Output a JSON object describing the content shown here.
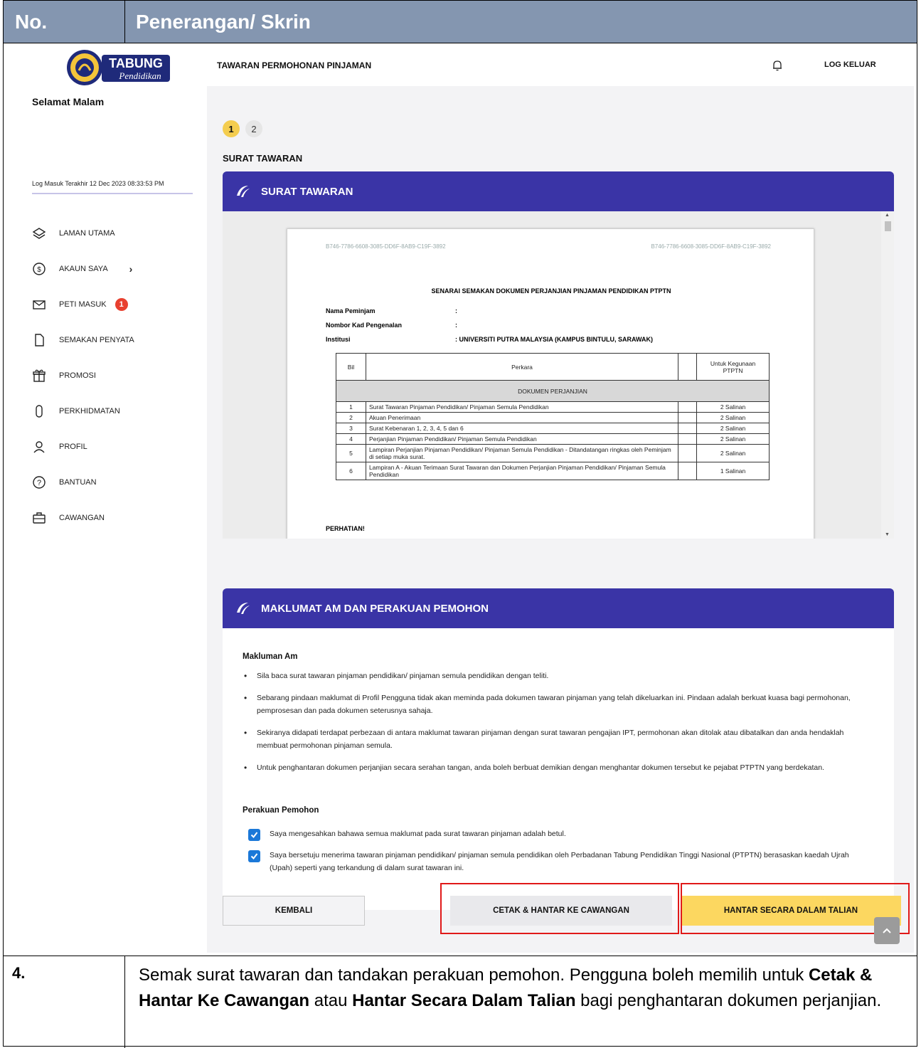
{
  "doc": {
    "header_no": "No.",
    "header_desc": "Penerangan/ Skrin",
    "step_no": "4.",
    "step_desc_1": "Semak surat tawaran dan tandakan perakuan pemohon. Pengguna boleh memilih untuk ",
    "step_desc_b1": "Cetak & Hantar Ke Cawangan",
    "step_desc_2": " atau ",
    "step_desc_b2": "Hantar Secara Dalam Talian",
    "step_desc_3": " bagi penghantaran dokumen perjanjian."
  },
  "logo": {
    "line1": "TABUNG",
    "line2": "Pendidikan"
  },
  "sidebar": {
    "greeting": "Selamat Malam",
    "last_login": "Log Masuk Terakhir 12 Dec 2023 08:33:53 PM",
    "items": [
      {
        "label": "LAMAN UTAMA",
        "icon": "layers-icon"
      },
      {
        "label": "AKAUN SAYA",
        "icon": "dollar-circle-icon"
      },
      {
        "label": "PETI MASUK",
        "icon": "mail-icon",
        "badge": "1"
      },
      {
        "label": "SEMAKAN PENYATA",
        "icon": "document-icon"
      },
      {
        "label": "PROMOSI",
        "icon": "gift-icon"
      },
      {
        "label": "PERKHIDMATAN",
        "icon": "mouse-icon"
      },
      {
        "label": "PROFIL",
        "icon": "user-icon"
      },
      {
        "label": "BANTUAN",
        "icon": "help-icon"
      },
      {
        "label": "CAWANGAN",
        "icon": "briefcase-icon"
      }
    ]
  },
  "header": {
    "title": "TAWARAN PERMOHONAN PINJAMAN",
    "logout": "LOG KELUAR"
  },
  "stepper": [
    "1",
    "2"
  ],
  "section_label": "SURAT TAWARAN",
  "card1": {
    "title": "SURAT TAWARAN"
  },
  "letter": {
    "code_left": "B746-7786-6608-3085-DD6F-8AB9-C19F-3892",
    "code_right": "B746-7786-6608-3085-DD6F-8AB9-C19F-3892",
    "title": "SENARAI SEMAKAN DOKUMEN PERJANJIAN PINJAMAN PENDIDIKAN PTPTN",
    "fields": [
      {
        "k": "Nama Peminjam",
        "v": ":"
      },
      {
        "k": "Nombor Kad Pengenalan",
        "v": ":"
      },
      {
        "k": "Institusi",
        "v": ": UNIVERSITI PUTRA MALAYSIA (KAMPUS BINTULU, SARAWAK)"
      }
    ],
    "table_headers": [
      "Bil",
      "Perkara",
      "",
      "Untuk Kegunaan PTPTN"
    ],
    "group": "DOKUMEN PERJANJIAN",
    "rows": [
      {
        "bil": "1",
        "perkara": "Surat Tawaran Pinjaman Pendidikan/ Pinjaman Semula Pendidikan",
        "guna": "2 Salinan"
      },
      {
        "bil": "2",
        "perkara": "Akuan Penerimaan",
        "guna": "2 Salinan"
      },
      {
        "bil": "3",
        "perkara": "Surat Kebenaran 1, 2, 3, 4, 5 dan 6",
        "guna": "2 Salinan"
      },
      {
        "bil": "4",
        "perkara": "Perjanjian Pinjaman Pendidikan/ Pinjaman Semula Pendidikan",
        "guna": "2 Salinan"
      },
      {
        "bil": "5",
        "perkara": "Lampiran Perjanjian Pinjaman Pendidikan/ Pinjaman Semula Pendidikan - Ditandatangan ringkas oleh Peminjam di setiap muka surat.",
        "guna": "2 Salinan"
      },
      {
        "bil": "6",
        "perkara": "Lampiran A - Akuan Terimaan Surat Tawaran dan Dokumen Perjanjian Pinjaman Pendidikan/ Pinjaman Semula Pendidikan",
        "guna": "1 Salinan"
      }
    ],
    "perhatian": "PERHATIAN!"
  },
  "card2": {
    "title": "MAKLUMAT AM DAN PERAKUAN PEMOHON",
    "makluman_heading": "Makluman Am",
    "bullets": [
      "Sila baca surat tawaran pinjaman pendidikan/ pinjaman semula pendidikan dengan teliti.",
      "Sebarang pindaan maklumat di Profil Pengguna tidak akan meminda pada dokumen tawaran pinjaman yang telah dikeluarkan ini. Pindaan adalah berkuat kuasa bagi permohonan, pemprosesan dan pada dokumen seterusnya sahaja.",
      "Sekiranya didapati terdapat perbezaan di antara maklumat tawaran pinjaman dengan surat tawaran pengajian IPT, permohonan akan ditolak atau dibatalkan dan anda hendaklah membuat permohonan pinjaman semula.",
      "Untuk penghantaran dokumen perjanjian secara serahan tangan, anda boleh berbuat demikian dengan menghantar dokumen tersebut ke pejabat PTPTN yang berdekatan."
    ],
    "perakuan_heading": "Perakuan Pemohon",
    "checks": [
      "Saya mengesahkan bahawa semua maklumat pada surat tawaran pinjaman adalah betul.",
      "Saya bersetuju menerima tawaran pinjaman pendidikan/ pinjaman semula pendidikan oleh Perbadanan Tabung Pendidikan Tinggi Nasional (PTPTN) berasaskan kaedah Ujrah (Upah) seperti yang terkandung di dalam surat tawaran ini."
    ]
  },
  "buttons": {
    "back": "KEMBALI",
    "print": "CETAK & HANTAR KE CAWANGAN",
    "online": "HANTAR SECARA DALAM TALIAN"
  },
  "colors": {
    "header_bg": "#8496b0",
    "card_head": "#3a34a6",
    "primary_btn": "#fcd760",
    "highlight": "#e01919",
    "checkbox": "#1b78d8",
    "badge": "#e8402f"
  }
}
